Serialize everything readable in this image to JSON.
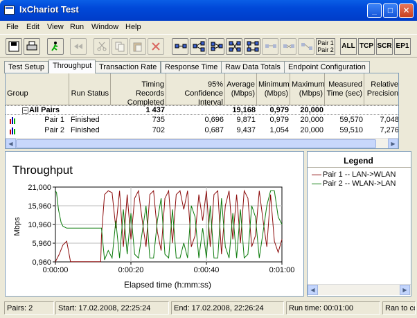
{
  "window": {
    "title": "IxChariot Test"
  },
  "menu": [
    "File",
    "Edit",
    "View",
    "Run",
    "Window",
    "Help"
  ],
  "toolbar": {
    "pair_label_1": "Pair 1",
    "pair_label_2": "Pair 2",
    "buttons_text": [
      "ALL",
      "TCP",
      "SCR",
      "EP1"
    ]
  },
  "tabs": [
    "Test Setup",
    "Throughput",
    "Transaction Rate",
    "Response Time",
    "Raw Data Totals",
    "Endpoint Configuration"
  ],
  "grid": {
    "headers": [
      [
        "Group"
      ],
      [
        "Run Status"
      ],
      [
        "Timing Records",
        "Completed"
      ],
      [
        "95% Confidence",
        "Interval"
      ],
      [
        "Average",
        "(Mbps)"
      ],
      [
        "Minimum",
        "(Mbps)"
      ],
      [
        "Maximum",
        "(Mbps)"
      ],
      [
        "Measured",
        "Time (sec)"
      ],
      [
        "Relative",
        "Precision"
      ]
    ],
    "all_pairs": {
      "label": "All Pairs",
      "records": "1 437",
      "average": "19,168",
      "minimum": "0,979",
      "maximum": "20,000"
    },
    "rows": [
      {
        "name": "Pair 1",
        "status": "Finished",
        "records": "735",
        "confidence": "0,696",
        "average": "9,871",
        "minimum": "0,979",
        "maximum": "20,000",
        "time": "59,570",
        "precision": "7,048"
      },
      {
        "name": "Pair 2",
        "status": "Finished",
        "records": "702",
        "confidence": "0,687",
        "average": "9,437",
        "minimum": "1,054",
        "maximum": "20,000",
        "time": "59,510",
        "precision": "7,276"
      }
    ]
  },
  "chart_data": {
    "type": "line",
    "title": "Throughput",
    "xlabel": "Elapsed time (h:mm:ss)",
    "ylabel": "Mbps",
    "xlim": [
      0,
      60
    ],
    "ylim": [
      0.96,
      21
    ],
    "x_ticks": [
      "0:00:00",
      "0:00:20",
      "0:00:40",
      "0:01:00"
    ],
    "y_ticks": [
      "21,000",
      "15,960",
      "10,960",
      "5,960",
      "0,960"
    ],
    "grid": true,
    "series": [
      {
        "name": "Pair 1 -- LAN->WLAN",
        "color": "#8b0a0a",
        "x": [
          0,
          1,
          2,
          3,
          4,
          12,
          12.2,
          13,
          14,
          15,
          16,
          17,
          18,
          19,
          20,
          21,
          22,
          23,
          24,
          25,
          26,
          27,
          28,
          29,
          30,
          31,
          32,
          33,
          34,
          35,
          36,
          37,
          38,
          39,
          40,
          41,
          42,
          43,
          44,
          45,
          46,
          47,
          48,
          49,
          50,
          51,
          52,
          53,
          54,
          55,
          56,
          57,
          58,
          59,
          60
        ],
        "y": [
          1.0,
          3.0,
          5.5,
          6.5,
          1.0,
          1.0,
          8.0,
          19.0,
          20.0,
          19.5,
          10.0,
          20.0,
          5.0,
          19.0,
          7.0,
          18.0,
          20.0,
          12.0,
          5.0,
          19.0,
          20.0,
          9.0,
          4.0,
          18.0,
          20.0,
          6.0,
          19.0,
          20.0,
          15.0,
          20.0,
          5.0,
          8.0,
          19.0,
          12.0,
          20.0,
          5.0,
          19.0,
          20.0,
          3.0,
          16.0,
          20.0,
          7.0,
          19.0,
          6.0,
          20.0,
          18.0,
          5.0,
          8.0,
          20.0,
          12.0,
          5.0,
          19.0,
          6.5,
          3.5,
          7.0
        ]
      },
      {
        "name": "Pair 2 -- WLAN->LAN",
        "color": "#0a7a0a",
        "x": [
          0,
          0.3,
          0.8,
          1.5,
          2,
          3,
          4,
          12,
          12.2,
          13,
          14,
          15,
          16,
          17,
          18,
          19,
          20,
          21,
          22,
          23,
          24,
          25,
          26,
          27,
          28,
          29,
          30,
          31,
          32,
          33,
          34,
          35,
          36,
          37,
          38,
          39,
          40,
          41,
          42,
          43,
          44,
          45,
          46,
          47,
          48,
          49,
          50,
          51,
          52,
          53,
          54,
          55,
          56,
          57,
          58,
          59,
          60
        ],
        "y": [
          20.0,
          19.5,
          15.0,
          11.5,
          10.5,
          10.0,
          10.0,
          10.0,
          10.0,
          1.5,
          4.0,
          2.0,
          12.0,
          2.0,
          15.0,
          3.0,
          14.0,
          3.0,
          2.0,
          9.0,
          16.0,
          2.0,
          2.0,
          12.0,
          18.0,
          3.0,
          2.0,
          15.0,
          2.0,
          2.0,
          6.0,
          2.0,
          16.0,
          13.0,
          2.0,
          10.0,
          2.0,
          16.0,
          2.0,
          2.0,
          18.0,
          5.0,
          2.0,
          14.0,
          2.0,
          15.0,
          2.0,
          3.0,
          16.0,
          13.0,
          2.0,
          9.0,
          16.0,
          20.0,
          20.0,
          13.0,
          11.0
        ]
      }
    ]
  },
  "legend": {
    "title": "Legend",
    "items": [
      "Pair 1 -- LAN->WLAN",
      "Pair 2 -- WLAN->LAN"
    ]
  },
  "status": {
    "pairs": "Pairs: 2",
    "start": "Start: 17.02.2008, 22:25:24",
    "end": "End: 17.02.2008, 22:26:24",
    "runtime": "Run time: 00:01:00",
    "ran": "Ran to co"
  }
}
